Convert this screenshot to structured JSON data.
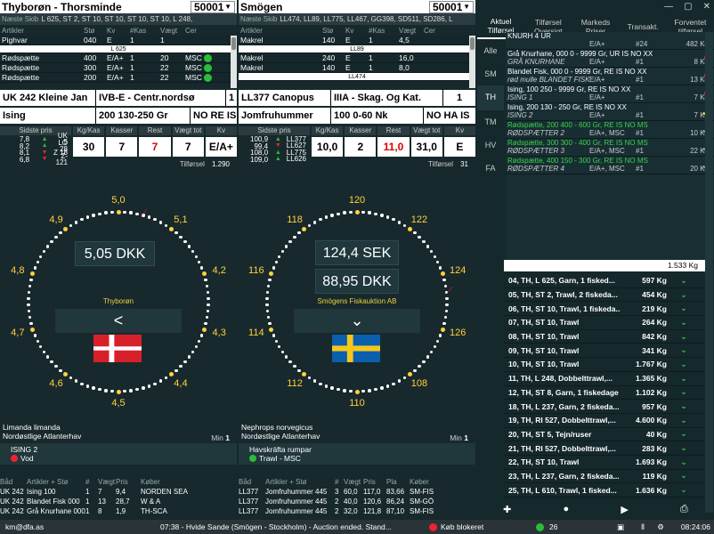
{
  "panel1": {
    "title": "Thyborøn - Thorsminde",
    "number": "50001",
    "lane_label": "Næste Skib",
    "lane_value": "L 625, ST 2, ST 10, ST 10, ST 10, ST 10, L 248,",
    "headers": [
      "Artikler",
      "Stø",
      "Kv",
      "#Kas",
      "Vægt",
      "Cer"
    ],
    "rows": [
      {
        "a": "Pighvar",
        "s": "040",
        "k": "E",
        "n": "1",
        "v": "1",
        "c": ""
      },
      {
        "sep": "L 625"
      },
      {
        "a": "Rødspætte",
        "s": "400",
        "k": "E/A+",
        "n": "1",
        "v": "20",
        "c": "MSC"
      },
      {
        "a": "Rødspætte",
        "s": "300",
        "k": "E/A+",
        "n": "1",
        "v": "22",
        "c": "MSC"
      },
      {
        "a": "Rødspætte",
        "s": "200",
        "k": "E/A+",
        "n": "1",
        "v": "22",
        "c": "MSC"
      }
    ],
    "w1": [
      "UK 242 Kleine Jan",
      "IVB-E - Centr.nordsø",
      "1"
    ],
    "w2": [
      "Ising",
      "200 130-250 Gr",
      "NO RE IS"
    ],
    "sidste_hd": "Sidste pris",
    "sidste": [
      {
        "p": "7,8",
        "d": "up",
        "s": "UK 5"
      },
      {
        "p": "8,2",
        "d": "up",
        "s": "LO 28"
      },
      {
        "p": "8,1",
        "d": "dn",
        "s": "Z 18"
      },
      {
        "p": "6,8",
        "d": "dn",
        "s": "Z-121"
      }
    ],
    "stats": [
      {
        "h": "Kg/Kas",
        "v": "30",
        "red": false
      },
      {
        "h": "Kasser",
        "v": "7",
        "red": false
      },
      {
        "h": "Rest",
        "v": "7",
        "red": true
      },
      {
        "h": "Vægt tot",
        "v": "7",
        "red": false
      },
      {
        "h": "Kv",
        "v": "E/A+",
        "red": false
      }
    ],
    "tilf_label": "Tilførsel",
    "tilf_value": "1.290",
    "dial_labels": [
      "5,0",
      "5,1",
      "4,2",
      "4,3",
      "4,4",
      "4,5",
      "4,6",
      "4,7",
      "4,8",
      "4,9"
    ],
    "price1": "5,05 DKK",
    "auction_name": "Thyborøn",
    "nav_label": "<",
    "species1": "Limanda limanda",
    "species2": "Nordøstlige Atlanterhav",
    "min_label": "Min",
    "min_value": "1",
    "ising1": "ISING  2",
    "ising2": "Vod",
    "btab_headers": [
      "Båd",
      "Artikler + Stø",
      "#",
      "Vægt",
      "Pris",
      "Køber"
    ],
    "btab_rows": [
      [
        "UK 242",
        "Ising 100",
        "1",
        "7",
        "9,4",
        "NORDEN SEA"
      ],
      [
        "UK 242",
        "Blandet Fisk 000",
        "1",
        "13",
        "28,7",
        "W & A"
      ],
      [
        "UK 242",
        "Grå Knurhane 000",
        "1",
        "8",
        "1,9",
        "TH-SCA"
      ]
    ]
  },
  "panel2": {
    "title": "Smögen",
    "number": "50001",
    "lane_label": "Næste Skib",
    "lane_value": "LL474, LL89, LL775, LL467, GG398, SD511, SD286, L",
    "headers": [
      "Artikler",
      "Stø",
      "Kv",
      "#Kas",
      "Vægt",
      "Cer"
    ],
    "rows": [
      {
        "a": "Makrel",
        "s": "140",
        "k": "E",
        "n": "1",
        "v": "4,5",
        "c": ""
      },
      {
        "sep": "LL89"
      },
      {
        "a": "Makrel",
        "s": "240",
        "k": "E",
        "n": "1",
        "v": "16,0",
        "c": ""
      },
      {
        "a": "Makrel",
        "s": "140",
        "k": "E",
        "n": "1",
        "v": "8,0",
        "c": ""
      },
      {
        "sep": "LL474"
      }
    ],
    "w1": [
      "LL377 Canopus",
      "IIIA - Skag. Og Kat.",
      "1"
    ],
    "w2": [
      "Jomfruhummer",
      "100 0-60 Nk",
      "NO HA IS"
    ],
    "sidste_hd": "Sidste pris",
    "sidste": [
      {
        "p": "100,9",
        "d": "up",
        "s": "LL377"
      },
      {
        "p": "99,4",
        "d": "dn",
        "s": "LL627"
      },
      {
        "p": "108,0",
        "d": "up",
        "s": "LL775"
      },
      {
        "p": "109,0",
        "d": "up",
        "s": "LL626"
      }
    ],
    "stats": [
      {
        "h": "Kg/Kas",
        "v": "10,0",
        "red": false
      },
      {
        "h": "Kasser",
        "v": "2",
        "red": false
      },
      {
        "h": "Rest",
        "v": "11,0",
        "red": true
      },
      {
        "h": "Vægt tot",
        "v": "31,0",
        "red": false
      },
      {
        "h": "Kv",
        "v": "E",
        "red": false
      }
    ],
    "tilf_label": "Tilførsel",
    "tilf_value": "31",
    "dial_labels": [
      "120",
      "122",
      "124",
      "126",
      "108",
      "110",
      "112",
      "114",
      "116",
      "118"
    ],
    "price1": "124,4 SEK",
    "price2": "88,95 DKK",
    "auction_name": "Smögens Fiskauktion AB",
    "nav_label": "⌄",
    "species1": "Nephrops norvegicus",
    "species2": "Nordøstlige Atlanterhav",
    "min_label": "Min",
    "min_value": "1",
    "ising1": "Havskräfta rumpar",
    "ising2": "Trawl - MSC",
    "btab_headers": [
      "Båd",
      "Artikler + Stø",
      "#",
      "Vægt",
      "Pris",
      "Pla",
      "Køber"
    ],
    "btab_rows": [
      [
        "LL377",
        "Jomfruhummer 445",
        "3",
        "60,0",
        "117,0",
        "83,66",
        "SM-FIS"
      ],
      [
        "LL377",
        "Jomfruhummer 445",
        "2",
        "40,0",
        "120,6",
        "86,24",
        "SM-GÖ"
      ],
      [
        "LL377",
        "Jomfruhummer 445",
        "2",
        "32,0",
        "121,8",
        "87,10",
        "SM-FIS"
      ]
    ]
  },
  "right": {
    "tabs": [
      "Aktuel Tilførsel",
      "Tilførsel Oversigt",
      "Markeds Priser",
      "Transakt.",
      "Forventet tilførsel"
    ],
    "side": [
      "Alle",
      "SM",
      "TH",
      "TM",
      "HV",
      "FA"
    ],
    "supply": [
      {
        "t1": "KNURH 4 UR",
        "t2": [
          "",
          "E/A+",
          "#24",
          "482 Kg"
        ],
        "ic": "",
        "g": false
      },
      {
        "t1": "Grå Knurhane, 000 0 - 9999 Gr, UR IS NO XX",
        "t2": [
          "GRÅ KNURHANE",
          "E/A+",
          "#1",
          "8 Kg"
        ],
        "ic": "red",
        "g": false
      },
      {
        "t1": "Blandet Fisk, 000 0 - 9999 Gr, RE IS NO XX",
        "t2": [
          "rød mulle BLANDET FISK",
          "E/A+",
          "#1",
          "13 Kg"
        ],
        "ic": "red",
        "g": false
      },
      {
        "t1": "Ising, 100 250 - 9999 Gr, RE IS NO XX",
        "t2": [
          "ISING  1",
          "E/A+",
          "#1",
          "7 Kg"
        ],
        "ic": "red",
        "g": false
      },
      {
        "t1": "Ising, 200 130 - 250 Gr, RE IS NO XX",
        "t2": [
          "ISING  2",
          "E/A+",
          "#1",
          "7 Kg"
        ],
        "ic": "plusy",
        "g": false
      },
      {
        "t1": "Rødspætte, 200 400 - 600 Gr, RE IS NO MS",
        "t2": [
          "RØDSPÆTTER 2",
          "E/A+, MSC",
          "#1",
          "10 Kg"
        ],
        "ic": "plus",
        "g": true
      },
      {
        "t1": "Rødspætte, 300 300 - 400 Gr, RE IS NO MS",
        "t2": [
          "RØDSPÆTTER 3",
          "E/A+, MSC",
          "#1",
          "22 Kg"
        ],
        "ic": "plus",
        "g": true
      },
      {
        "t1": "Rødspætte, 400 150 - 300 Gr, RE IS NO MS",
        "t2": [
          "RØDSPÆTTER 4",
          "E/A+, MSC",
          "#1",
          "20 Kg"
        ],
        "ic": "plus",
        "g": true
      }
    ],
    "total": "1.533 Kg",
    "trips": [
      [
        "04, TH, L 625, Garn, 1 fisked...",
        "597 Kg"
      ],
      [
        "05, TH, ST 2, Trawl, 2 fiskeda...",
        "454 Kg"
      ],
      [
        "06, TH, ST 10, Trawl, 1 fiskeda...",
        "219 Kg"
      ],
      [
        "07, TH, ST 10, Trawl",
        "264 Kg"
      ],
      [
        "08, TH, ST 10, Trawl",
        "842 Kg"
      ],
      [
        "09, TH, ST 10, Trawl",
        "341 Kg"
      ],
      [
        "10, TH, ST 10, Trawl",
        "1.767 Kg"
      ],
      [
        "11, TH, L 248, Dobbelttrawl,...",
        "1.365 Kg"
      ],
      [
        "12, TH, ST 8, Garn, 1 fiskedage",
        "1.102 Kg"
      ],
      [
        "18, TH, L 237, Garn, 2 fiskeda...",
        "957 Kg"
      ],
      [
        "19, TH, RI 527, Dobbelttrawl,...",
        "4.600 Kg"
      ],
      [
        "20, TH, ST 5, Tejn/ruser",
        "40 Kg"
      ],
      [
        "21, TH, RI 527, Dobbelttrawl,...",
        "283 Kg"
      ],
      [
        "22, TH, ST 10, Trawl",
        "1.693 Kg"
      ],
      [
        "23, TH, L 237, Garn, 2 fiskeda...",
        "119 Kg"
      ],
      [
        "25, TH, L 610, Trawl, 1 fisked...",
        "1.636 Kg"
      ]
    ]
  },
  "status": {
    "email": "km@dfa.as",
    "message": "07:38 - Hvide Sande (Smögen - Stockholm) - Auction ended. Stand...",
    "blocked": "Køb blokeret",
    "count": "26",
    "time": "08:24:06"
  }
}
